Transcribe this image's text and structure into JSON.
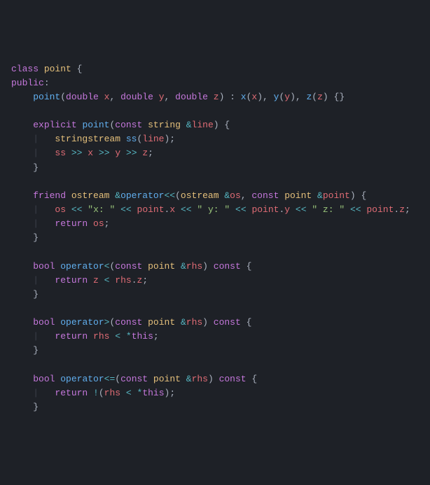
{
  "code": {
    "lines": [
      [
        {
          "cls": "kw",
          "t": "class"
        },
        {
          "cls": "pn",
          "t": " "
        },
        {
          "cls": "cls",
          "t": "point"
        },
        {
          "cls": "pn",
          "t": " {"
        }
      ],
      [
        {
          "cls": "kw",
          "t": "public"
        },
        {
          "cls": "pn",
          "t": ":"
        }
      ],
      [
        {
          "cls": "pn",
          "t": "    "
        },
        {
          "cls": "fn",
          "t": "point"
        },
        {
          "cls": "pn",
          "t": "("
        },
        {
          "cls": "kw",
          "t": "double"
        },
        {
          "cls": "pn",
          "t": " "
        },
        {
          "cls": "id",
          "t": "x"
        },
        {
          "cls": "pn",
          "t": ", "
        },
        {
          "cls": "kw",
          "t": "double"
        },
        {
          "cls": "pn",
          "t": " "
        },
        {
          "cls": "id",
          "t": "y"
        },
        {
          "cls": "pn",
          "t": ", "
        },
        {
          "cls": "kw",
          "t": "double"
        },
        {
          "cls": "pn",
          "t": " "
        },
        {
          "cls": "id",
          "t": "z"
        },
        {
          "cls": "pn",
          "t": ") : "
        },
        {
          "cls": "fn",
          "t": "x"
        },
        {
          "cls": "pn",
          "t": "("
        },
        {
          "cls": "id",
          "t": "x"
        },
        {
          "cls": "pn",
          "t": "), "
        },
        {
          "cls": "fn",
          "t": "y"
        },
        {
          "cls": "pn",
          "t": "("
        },
        {
          "cls": "id",
          "t": "y"
        },
        {
          "cls": "pn",
          "t": "), "
        },
        {
          "cls": "fn",
          "t": "z"
        },
        {
          "cls": "pn",
          "t": "("
        },
        {
          "cls": "id",
          "t": "z"
        },
        {
          "cls": "pn",
          "t": ") {}"
        }
      ],
      [
        {
          "cls": "pn",
          "t": ""
        }
      ],
      [
        {
          "cls": "pn",
          "t": "    "
        },
        {
          "cls": "kw",
          "t": "explicit"
        },
        {
          "cls": "pn",
          "t": " "
        },
        {
          "cls": "fn",
          "t": "point"
        },
        {
          "cls": "pn",
          "t": "("
        },
        {
          "cls": "kw",
          "t": "const"
        },
        {
          "cls": "pn",
          "t": " "
        },
        {
          "cls": "ty",
          "t": "string"
        },
        {
          "cls": "pn",
          "t": " "
        },
        {
          "cls": "op",
          "t": "&"
        },
        {
          "cls": "id",
          "t": "line"
        },
        {
          "cls": "pn",
          "t": ") {"
        }
      ],
      [
        {
          "cls": "ind",
          "t": "    |   "
        },
        {
          "cls": "ty",
          "t": "stringstream"
        },
        {
          "cls": "pn",
          "t": " "
        },
        {
          "cls": "fn",
          "t": "ss"
        },
        {
          "cls": "pn",
          "t": "("
        },
        {
          "cls": "id",
          "t": "line"
        },
        {
          "cls": "pn",
          "t": ");"
        }
      ],
      [
        {
          "cls": "ind",
          "t": "    |   "
        },
        {
          "cls": "id",
          "t": "ss"
        },
        {
          "cls": "pn",
          "t": " "
        },
        {
          "cls": "op",
          "t": ">>"
        },
        {
          "cls": "pn",
          "t": " "
        },
        {
          "cls": "id",
          "t": "x"
        },
        {
          "cls": "pn",
          "t": " "
        },
        {
          "cls": "op",
          "t": ">>"
        },
        {
          "cls": "pn",
          "t": " "
        },
        {
          "cls": "id",
          "t": "y"
        },
        {
          "cls": "pn",
          "t": " "
        },
        {
          "cls": "op",
          "t": ">>"
        },
        {
          "cls": "pn",
          "t": " "
        },
        {
          "cls": "id",
          "t": "z"
        },
        {
          "cls": "pn",
          "t": ";"
        }
      ],
      [
        {
          "cls": "pn",
          "t": "    }"
        }
      ],
      [
        {
          "cls": "pn",
          "t": ""
        }
      ],
      [
        {
          "cls": "pn",
          "t": "    "
        },
        {
          "cls": "kw",
          "t": "friend"
        },
        {
          "cls": "pn",
          "t": " "
        },
        {
          "cls": "ty",
          "t": "ostream"
        },
        {
          "cls": "pn",
          "t": " "
        },
        {
          "cls": "op",
          "t": "&"
        },
        {
          "cls": "fn",
          "t": "operator"
        },
        {
          "cls": "op",
          "t": "<<"
        },
        {
          "cls": "pn",
          "t": "("
        },
        {
          "cls": "ty",
          "t": "ostream"
        },
        {
          "cls": "pn",
          "t": " "
        },
        {
          "cls": "op",
          "t": "&"
        },
        {
          "cls": "id",
          "t": "os"
        },
        {
          "cls": "pn",
          "t": ", "
        },
        {
          "cls": "kw",
          "t": "const"
        },
        {
          "cls": "pn",
          "t": " "
        },
        {
          "cls": "ty",
          "t": "point"
        },
        {
          "cls": "pn",
          "t": " "
        },
        {
          "cls": "op",
          "t": "&"
        },
        {
          "cls": "id",
          "t": "point"
        },
        {
          "cls": "pn",
          "t": ") {"
        }
      ],
      [
        {
          "cls": "ind",
          "t": "    |   "
        },
        {
          "cls": "id",
          "t": "os"
        },
        {
          "cls": "pn",
          "t": " "
        },
        {
          "cls": "op",
          "t": "<<"
        },
        {
          "cls": "pn",
          "t": " "
        },
        {
          "cls": "str",
          "t": "\"x: \""
        },
        {
          "cls": "pn",
          "t": " "
        },
        {
          "cls": "op",
          "t": "<<"
        },
        {
          "cls": "pn",
          "t": " "
        },
        {
          "cls": "id",
          "t": "point"
        },
        {
          "cls": "pn",
          "t": "."
        },
        {
          "cls": "id",
          "t": "x"
        },
        {
          "cls": "pn",
          "t": " "
        },
        {
          "cls": "op",
          "t": "<<"
        },
        {
          "cls": "pn",
          "t": " "
        },
        {
          "cls": "str",
          "t": "\" y: \""
        },
        {
          "cls": "pn",
          "t": " "
        },
        {
          "cls": "op",
          "t": "<<"
        },
        {
          "cls": "pn",
          "t": " "
        },
        {
          "cls": "id",
          "t": "point"
        },
        {
          "cls": "pn",
          "t": "."
        },
        {
          "cls": "id",
          "t": "y"
        },
        {
          "cls": "pn",
          "t": " "
        },
        {
          "cls": "op",
          "t": "<<"
        },
        {
          "cls": "pn",
          "t": " "
        },
        {
          "cls": "str",
          "t": "\" z: \""
        },
        {
          "cls": "pn",
          "t": " "
        },
        {
          "cls": "op",
          "t": "<<"
        },
        {
          "cls": "pn",
          "t": " "
        },
        {
          "cls": "id",
          "t": "point"
        },
        {
          "cls": "pn",
          "t": "."
        },
        {
          "cls": "id",
          "t": "z"
        },
        {
          "cls": "pn",
          "t": ";"
        }
      ],
      [
        {
          "cls": "ind",
          "t": "    |   "
        },
        {
          "cls": "kw",
          "t": "return"
        },
        {
          "cls": "pn",
          "t": " "
        },
        {
          "cls": "id",
          "t": "os"
        },
        {
          "cls": "pn",
          "t": ";"
        }
      ],
      [
        {
          "cls": "pn",
          "t": "    }"
        }
      ],
      [
        {
          "cls": "pn",
          "t": ""
        }
      ],
      [
        {
          "cls": "pn",
          "t": "    "
        },
        {
          "cls": "kw",
          "t": "bool"
        },
        {
          "cls": "pn",
          "t": " "
        },
        {
          "cls": "fn",
          "t": "operator"
        },
        {
          "cls": "op",
          "t": "<"
        },
        {
          "cls": "pn",
          "t": "("
        },
        {
          "cls": "kw",
          "t": "const"
        },
        {
          "cls": "pn",
          "t": " "
        },
        {
          "cls": "ty",
          "t": "point"
        },
        {
          "cls": "pn",
          "t": " "
        },
        {
          "cls": "op",
          "t": "&"
        },
        {
          "cls": "id",
          "t": "rhs"
        },
        {
          "cls": "pn",
          "t": ") "
        },
        {
          "cls": "kw",
          "t": "const"
        },
        {
          "cls": "pn",
          "t": " {"
        }
      ],
      [
        {
          "cls": "ind",
          "t": "    |   "
        },
        {
          "cls": "kw",
          "t": "return"
        },
        {
          "cls": "pn",
          "t": " "
        },
        {
          "cls": "id",
          "t": "z"
        },
        {
          "cls": "pn",
          "t": " "
        },
        {
          "cls": "op",
          "t": "<"
        },
        {
          "cls": "pn",
          "t": " "
        },
        {
          "cls": "id",
          "t": "rhs"
        },
        {
          "cls": "pn",
          "t": "."
        },
        {
          "cls": "id",
          "t": "z"
        },
        {
          "cls": "pn",
          "t": ";"
        }
      ],
      [
        {
          "cls": "pn",
          "t": "    }"
        }
      ],
      [
        {
          "cls": "pn",
          "t": ""
        }
      ],
      [
        {
          "cls": "pn",
          "t": "    "
        },
        {
          "cls": "kw",
          "t": "bool"
        },
        {
          "cls": "pn",
          "t": " "
        },
        {
          "cls": "fn",
          "t": "operator"
        },
        {
          "cls": "op",
          "t": ">"
        },
        {
          "cls": "pn",
          "t": "("
        },
        {
          "cls": "kw",
          "t": "const"
        },
        {
          "cls": "pn",
          "t": " "
        },
        {
          "cls": "ty",
          "t": "point"
        },
        {
          "cls": "pn",
          "t": " "
        },
        {
          "cls": "op",
          "t": "&"
        },
        {
          "cls": "id",
          "t": "rhs"
        },
        {
          "cls": "pn",
          "t": ") "
        },
        {
          "cls": "kw",
          "t": "const"
        },
        {
          "cls": "pn",
          "t": " {"
        }
      ],
      [
        {
          "cls": "ind",
          "t": "    |   "
        },
        {
          "cls": "kw",
          "t": "return"
        },
        {
          "cls": "pn",
          "t": " "
        },
        {
          "cls": "id",
          "t": "rhs"
        },
        {
          "cls": "pn",
          "t": " "
        },
        {
          "cls": "op",
          "t": "<"
        },
        {
          "cls": "pn",
          "t": " "
        },
        {
          "cls": "op",
          "t": "*"
        },
        {
          "cls": "kw",
          "t": "this"
        },
        {
          "cls": "pn",
          "t": ";"
        }
      ],
      [
        {
          "cls": "pn",
          "t": "    }"
        }
      ],
      [
        {
          "cls": "pn",
          "t": ""
        }
      ],
      [
        {
          "cls": "pn",
          "t": "    "
        },
        {
          "cls": "kw",
          "t": "bool"
        },
        {
          "cls": "pn",
          "t": " "
        },
        {
          "cls": "fn",
          "t": "operator"
        },
        {
          "cls": "op",
          "t": "<="
        },
        {
          "cls": "pn",
          "t": "("
        },
        {
          "cls": "kw",
          "t": "const"
        },
        {
          "cls": "pn",
          "t": " "
        },
        {
          "cls": "ty",
          "t": "point"
        },
        {
          "cls": "pn",
          "t": " "
        },
        {
          "cls": "op",
          "t": "&"
        },
        {
          "cls": "id",
          "t": "rhs"
        },
        {
          "cls": "pn",
          "t": ") "
        },
        {
          "cls": "kw",
          "t": "const"
        },
        {
          "cls": "pn",
          "t": " {"
        }
      ],
      [
        {
          "cls": "ind",
          "t": "    |   "
        },
        {
          "cls": "kw",
          "t": "return"
        },
        {
          "cls": "pn",
          "t": " "
        },
        {
          "cls": "op",
          "t": "!"
        },
        {
          "cls": "pn",
          "t": "("
        },
        {
          "cls": "id",
          "t": "rhs"
        },
        {
          "cls": "pn",
          "t": " "
        },
        {
          "cls": "op",
          "t": "<"
        },
        {
          "cls": "pn",
          "t": " "
        },
        {
          "cls": "op",
          "t": "*"
        },
        {
          "cls": "kw",
          "t": "this"
        },
        {
          "cls": "pn",
          "t": ");"
        }
      ],
      [
        {
          "cls": "pn",
          "t": "    }"
        }
      ]
    ]
  }
}
